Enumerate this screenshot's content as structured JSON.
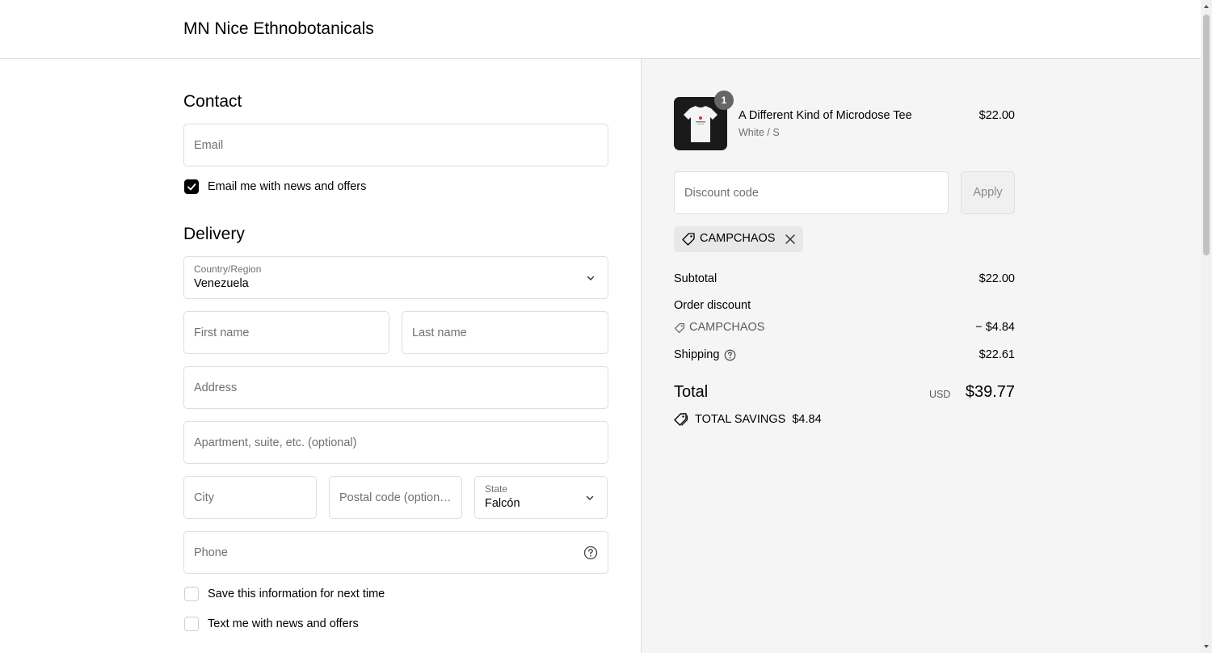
{
  "header": {
    "store_name": "MN Nice Ethnobotanicals"
  },
  "contact": {
    "title": "Contact",
    "email_placeholder": "Email",
    "newsletter_label": "Email me with news and offers",
    "newsletter_checked": true
  },
  "delivery": {
    "title": "Delivery",
    "country_label": "Country/Region",
    "country_value": "Venezuela",
    "first_name_placeholder": "First name",
    "last_name_placeholder": "Last name",
    "address_placeholder": "Address",
    "apartment_placeholder": "Apartment, suite, etc. (optional)",
    "city_placeholder": "City",
    "postal_placeholder": "Postal code (optional)",
    "state_label": "State",
    "state_value": "Falcón",
    "phone_placeholder": "Phone",
    "save_info_label": "Save this information for next time",
    "text_me_label": "Text me with news and offers"
  },
  "summary": {
    "product": {
      "name": "A Different Kind of Microdose Tee",
      "variant": "White / S",
      "price": "$22.00",
      "quantity": "1"
    },
    "discount_placeholder": "Discount code",
    "apply_label": "Apply",
    "applied_code": "CAMPCHAOS",
    "subtotal_label": "Subtotal",
    "subtotal_value": "$22.00",
    "order_discount_label": "Order discount",
    "discount_code_name": "CAMPCHAOS",
    "discount_value": "− $4.84",
    "shipping_label": "Shipping",
    "shipping_value": "$22.61",
    "total_label": "Total",
    "total_currency": "USD",
    "total_value": "$39.77",
    "savings_label": "TOTAL SAVINGS",
    "savings_value": "$4.84"
  },
  "colors": {
    "accent": "#000000",
    "panel_bg": "#f5f5f5",
    "border": "#dedede",
    "muted_text": "#707070"
  }
}
